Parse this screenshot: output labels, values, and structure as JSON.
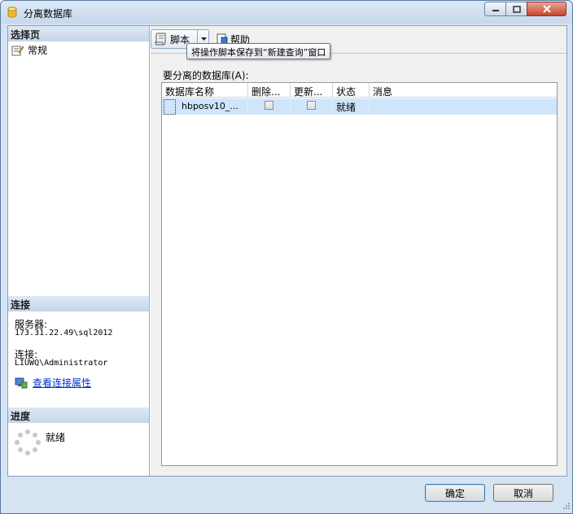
{
  "window": {
    "title": "分离数据库"
  },
  "left": {
    "select_page_header": "选择页",
    "nav_items": [
      {
        "label": "常规"
      }
    ],
    "connection_header": "连接",
    "server_label": "服务器:",
    "server_value": "173.31.22.49\\sql2012",
    "connection_label": "连接:",
    "connection_value": "LIUWQ\\Administrator",
    "view_connection_link": "查看连接属性",
    "progress_header": "进度",
    "progress_status": "就绪"
  },
  "toolbar": {
    "script_label": "脚本",
    "help_label": "帮助",
    "tooltip": "将操作脚本保存到“新建查询”窗口"
  },
  "grid": {
    "label": "要分离的数据库(A):",
    "columns": [
      "数据库名称",
      "删除...",
      "更新...",
      "状态",
      "消息"
    ],
    "rows": [
      {
        "name": "hbposv10_...",
        "drop": false,
        "update": false,
        "status": "就绪",
        "message": ""
      }
    ]
  },
  "buttons": {
    "ok": "确定",
    "cancel": "取消"
  },
  "colors": {
    "accent": "#3c7fb1",
    "selection": "#cfe5fb",
    "link": "#0033cc"
  }
}
